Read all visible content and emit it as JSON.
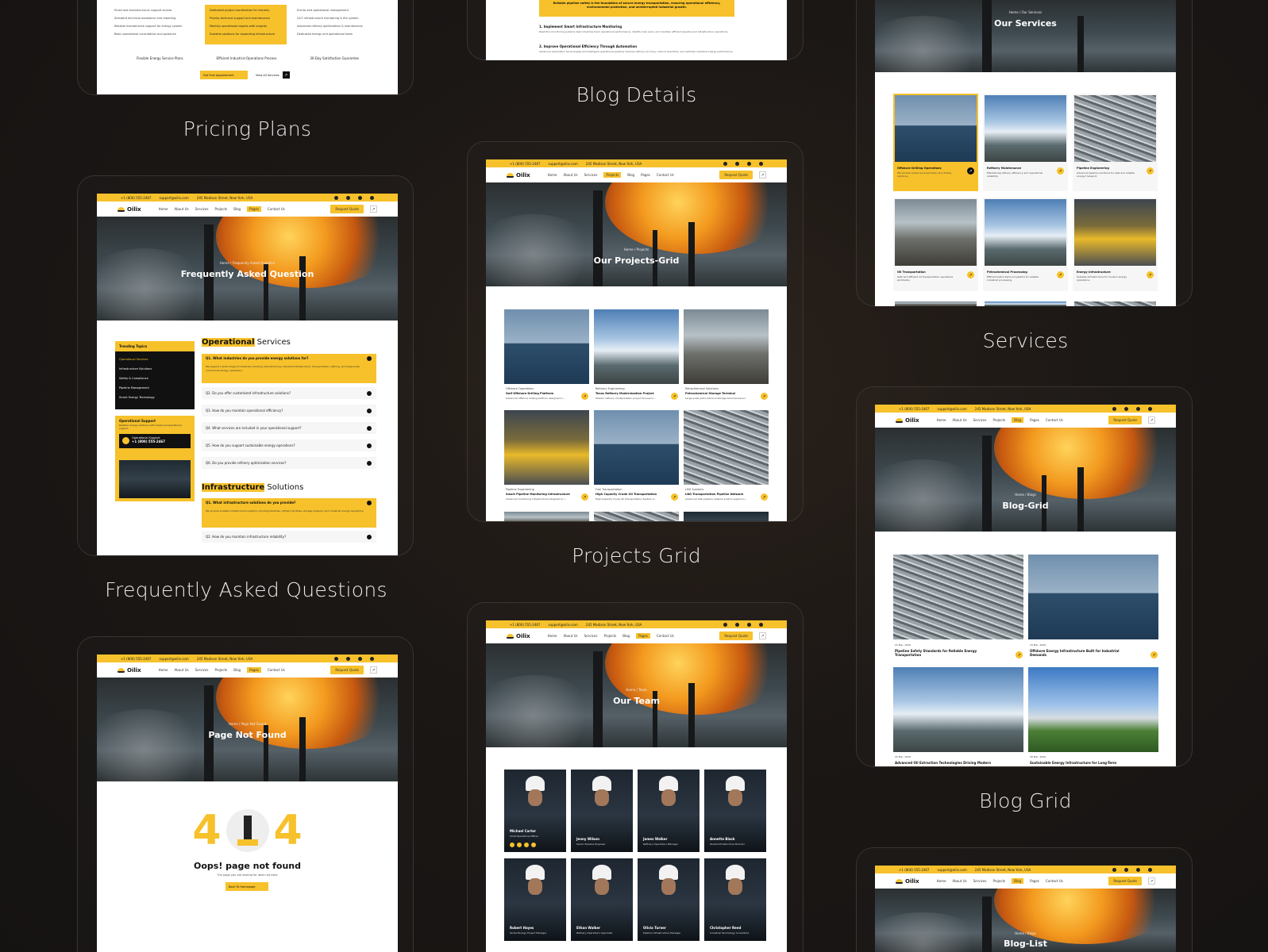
{
  "captions": {
    "pricing": "Pricing Plans",
    "blog_details": "Blog Details",
    "services": "Services",
    "faq": "Frequently Asked Questions",
    "projects_grid": "Projects Grid",
    "blog_grid": "Blog Grid"
  },
  "site": {
    "phone": "+1 (800) 555-2467",
    "email": "support@oilix.com",
    "address": "245 Madison Street, New York, USA",
    "logo": "Oilix",
    "nav": [
      "Home",
      "About Us",
      "Services",
      "Projects",
      "Blog",
      "Pages",
      "Contact Us"
    ],
    "request_quote": "Request Quote"
  },
  "pricing": {
    "col1": [
      "Email and business-hours support access",
      "Standard technical assistance and reporting",
      "Reliable maintenance support for energy system",
      "Basic operational consultation and guidance"
    ],
    "col2": [
      "Dedicated project coordination for industry",
      "Priority technical support and maintenance",
      "Monthly operational reports with insights",
      "Scalable solutions for expanding infrastructure"
    ],
    "col3": [
      "End-to-end operational management",
      "24/7 infrastructure monitoring & fire system",
      "Advanced refinery optimization & maintenance",
      "Dedicated energy and operational team"
    ],
    "features": [
      "Flexible Energy Service Plans",
      "Efficient Industrial Operations Process",
      "30-Day Satisfaction Guarantee"
    ],
    "btn_primary": "Get Free Appointment",
    "btn_secondary": "View All Services"
  },
  "blog_details": {
    "quote": "Reliable pipeline safety is the foundation of secure energy transportation, ensuring operational efficiency, environmental protection, and uninterrupted industrial growth.",
    "h1": "1. Implement Smart Infrastructure Monitoring",
    "p1": "Real-time monitoring systems help industries track operational performance, identify risks early, and maintain efficient pipeline and infrastructure operations.",
    "h2": "2. Improve Operational Efficiency Through Automation",
    "p2": "Advanced automation technologies and intelligent operational systems improve refinery accuracy, reduce downtime, and optimize industrial energy performance."
  },
  "services_page": {
    "crumb": "Home / Our Services",
    "title": "Our Services",
    "cards": [
      {
        "title": "Offshore Drilling Operations",
        "desc": "We provide advanced exploration and drilling solutions."
      },
      {
        "title": "Refinery Maintenance",
        "desc": "Maintaining refinery efficiency and operational reliability."
      },
      {
        "title": "Pipeline Engineering",
        "desc": "Advanced pipeline solutions for safe and reliable energy transport."
      },
      {
        "title": "Oil Transportation",
        "desc": "Safe and efficient oil transportation operations worldwide."
      },
      {
        "title": "Petrochemical Processing",
        "desc": "Efficient petrochemical systems for reliable industrial processing."
      },
      {
        "title": "Energy Infrastructure",
        "desc": "Scalable infrastructure for modern energy operations."
      }
    ]
  },
  "faq_page": {
    "crumb": "Home / Frequently Asked Question",
    "title": "Frequently Asked Question",
    "trending_title": "Trending Topics",
    "topics": [
      "Operational Services",
      "Infrastructure Solutions",
      "Safety & Compliance",
      "Pipeline Management",
      "Smart Energy Technology"
    ],
    "support_title": "Operational Support",
    "support_desc": "Reliable energy solutions with advanced operational support",
    "support_label": "Operational Support",
    "support_phone": "+1 (800) 555-2467",
    "sec1_hl": "Operational",
    "sec1_rest": " Services",
    "q1": "Q1. What industries do you provide energy solutions for?",
    "a1": "We support a wide range of industries including manufacturing, industrial infrastructure, transportation, refining, and large-scale commercial energy operations.",
    "q2": "Q2. Do you offer customized infrastructure solutions?",
    "q3": "Q3. How do you maintain operational efficiency?",
    "q4": "Q4. What services are included in your operational support?",
    "q5": "Q5. How do you support sustainable energy operations?",
    "q6": "Q6. Do you provide refinery optimization services?",
    "sec2_hl": "Infrastructure",
    "sec2_rest": " Solutions",
    "iq1": "Q1. What infrastructure solutions do you provide?",
    "ia1": "We provide scalable infrastructure systems including pipelines, refinery facilities, storage systems, and industrial energy operations.",
    "iq2": "Q2. How do you maintain infrastructure reliability?"
  },
  "projects_page": {
    "crumb": "Home / Projects",
    "title": "Our Projects-Grid",
    "items": [
      {
        "cat": "Offshore Operations",
        "title": "Gulf Offshore Drilling Platform",
        "desc": "Advanced offshore drilling platform designed to ..."
      },
      {
        "cat": "Refinery Engineering",
        "title": "Texas Refinery Modernization Project",
        "desc": "Modern refinery modernization project focused o..."
      },
      {
        "cat": "Petrochemical Solutions",
        "title": "Petrochemical Storage Terminal",
        "desc": "Large-scale petrochemical storage terminal devel..."
      },
      {
        "cat": "Pipeline Engineering",
        "title": "Smart Pipeline Monitoring Infrastructure",
        "desc": "Advanced monitoring infrastructure designed to i..."
      },
      {
        "cat": "Fuel Transportation",
        "title": "High Capacity Crude Oil Transportation",
        "desc": "High-Capacity Crude Oil Transportation System d..."
      },
      {
        "cat": "LNG Systems",
        "title": "LNG Transportation Pipeline Network",
        "desc": "Advanced LNG pipeline network built to support s..."
      }
    ]
  },
  "blog_grid_page": {
    "crumb": "Home / Blogs",
    "title": "Blog-Grid",
    "posts": [
      {
        "date": "22 Mar, 2026",
        "title": "Pipeline Safety Standards for Reliable Energy Transportation"
      },
      {
        "date": "24 Mar, 2026",
        "title": "Offshore Energy Infrastructure Built for Industrial Demands"
      },
      {
        "date": "20 Mar, 2026",
        "title": "Advanced Oil Extraction Technologies Driving Modern"
      },
      {
        "date": "28 Mar, 2026",
        "title": "Sustainable Energy Infrastructure for Long-Term"
      }
    ]
  },
  "notfound_page": {
    "crumb": "Home / Page Not Found",
    "title": "Page Not Found",
    "digit1": "4",
    "digit2": "4",
    "heading": "Oops! page not found",
    "sub": "The page you are looking for does not exist",
    "btn": "Back To Homepage"
  },
  "team_page": {
    "crumb": "Home / Team",
    "title": "Our Team",
    "members": [
      {
        "name": "Michael Carter",
        "role": "Chief Operations Officer"
      },
      {
        "name": "Jenny Wilson",
        "role": "Senior Pipeline Engineer"
      },
      {
        "name": "James Walker",
        "role": "Refinery Operations Manager"
      },
      {
        "name": "Annette Black",
        "role": "Global Infrastructure Director"
      },
      {
        "name": "Robert Hayes",
        "role": "Global Energy Project Manager"
      },
      {
        "name": "Ethan Walker",
        "role": "Refinery Operations Specialist"
      },
      {
        "name": "Olivia Turner",
        "role": "Pipeline Infrastructure Manager"
      },
      {
        "name": "Christopher Reed",
        "role": "Industrial Technology Consultant"
      }
    ]
  },
  "blog_list_page": {
    "crumb": "Home / Blogs",
    "title": "Blog-List"
  }
}
